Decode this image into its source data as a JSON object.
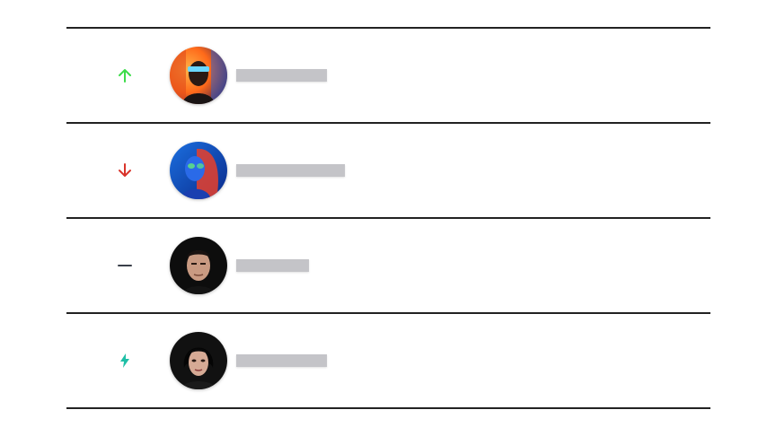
{
  "rows": [
    {
      "trend": "up",
      "trend_icon": "arrow-up-icon",
      "trend_color": "#3ddc4a",
      "avatar_style": "neon-visor"
    },
    {
      "trend": "down",
      "trend_icon": "arrow-down-icon",
      "trend_color": "#d9342b",
      "avatar_style": "blue-red-portrait"
    },
    {
      "trend": "same",
      "trend_icon": "dash-icon",
      "trend_color": "#3a3f4a",
      "avatar_style": "man-dark-background"
    },
    {
      "trend": "new",
      "trend_icon": "lightning-icon",
      "trend_color": "#1fbfa6",
      "avatar_style": "woman-dark-background"
    }
  ]
}
